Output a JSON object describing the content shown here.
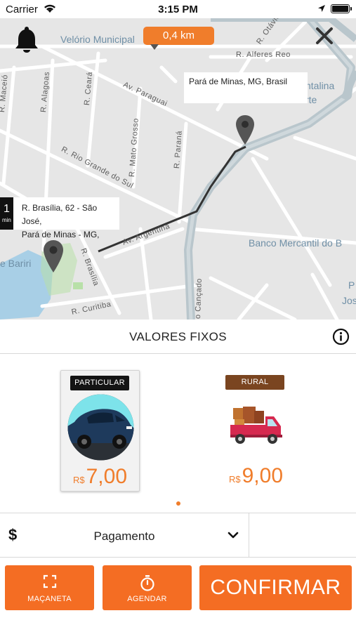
{
  "status_bar": {
    "carrier": "Carrier",
    "time": "3:15 PM",
    "icons": [
      "wifi-icon",
      "location-arrow-icon",
      "battery-icon"
    ]
  },
  "map": {
    "distance_badge": "0,4 km",
    "destination_callout": "Pará de Minas, MG, Brasil",
    "origin_callout": {
      "eta_value": "1",
      "eta_unit": "min",
      "address_line1": "R. Brasília, 62 - São José,",
      "address_line2": "Pará de Minas - MG,"
    },
    "places": {
      "velorio": "Velório Municipal",
      "ntalina": "ntalina",
      "rte": "rte",
      "banco": "Banco Mercantil do B",
      "bariri": "e Bariri",
      "p": "P",
      "jos": "Jos"
    },
    "streets": {
      "maceio": "R. Maceió",
      "alagoas": "R. Alagoas",
      "ceara": "R. Ceará",
      "paraguai": "Av. Paraguai",
      "mato_grosso": "R. Mato Grosso",
      "parana": "R. Paraná",
      "rio_grande": "R. Rio Grande do Sul",
      "alferes": "R. Alferes Reo",
      "otavio": "R. Otávio",
      "argentina": "Av. Argentina",
      "brasilia": "R. Brasília",
      "cancado": "o Cançado",
      "curitiba": "R. Curitiba"
    },
    "colors": {
      "route": "#333333",
      "highway": "#b9c6cc",
      "water": "#a8cfe6",
      "park": "#b8e0a8"
    }
  },
  "fixed_values": {
    "title": "VALORES FIXOS"
  },
  "vehicles": [
    {
      "tag": "PARTICULAR",
      "currency": "R$",
      "price": "7,00",
      "selected": true,
      "icon": "car-icon"
    },
    {
      "tag": "RURAL",
      "currency": "R$",
      "price": "9,00",
      "selected": false,
      "icon": "truck-icon"
    }
  ],
  "payment": {
    "label": "Pagamento"
  },
  "actions": {
    "macaneta": "MAÇANETA",
    "agendar": "AGENDAR",
    "confirmar": "CONFIRMAR"
  },
  "colors": {
    "accent": "#f07d2b",
    "button": "#f46d23",
    "rural_tag": "#7a4520"
  }
}
